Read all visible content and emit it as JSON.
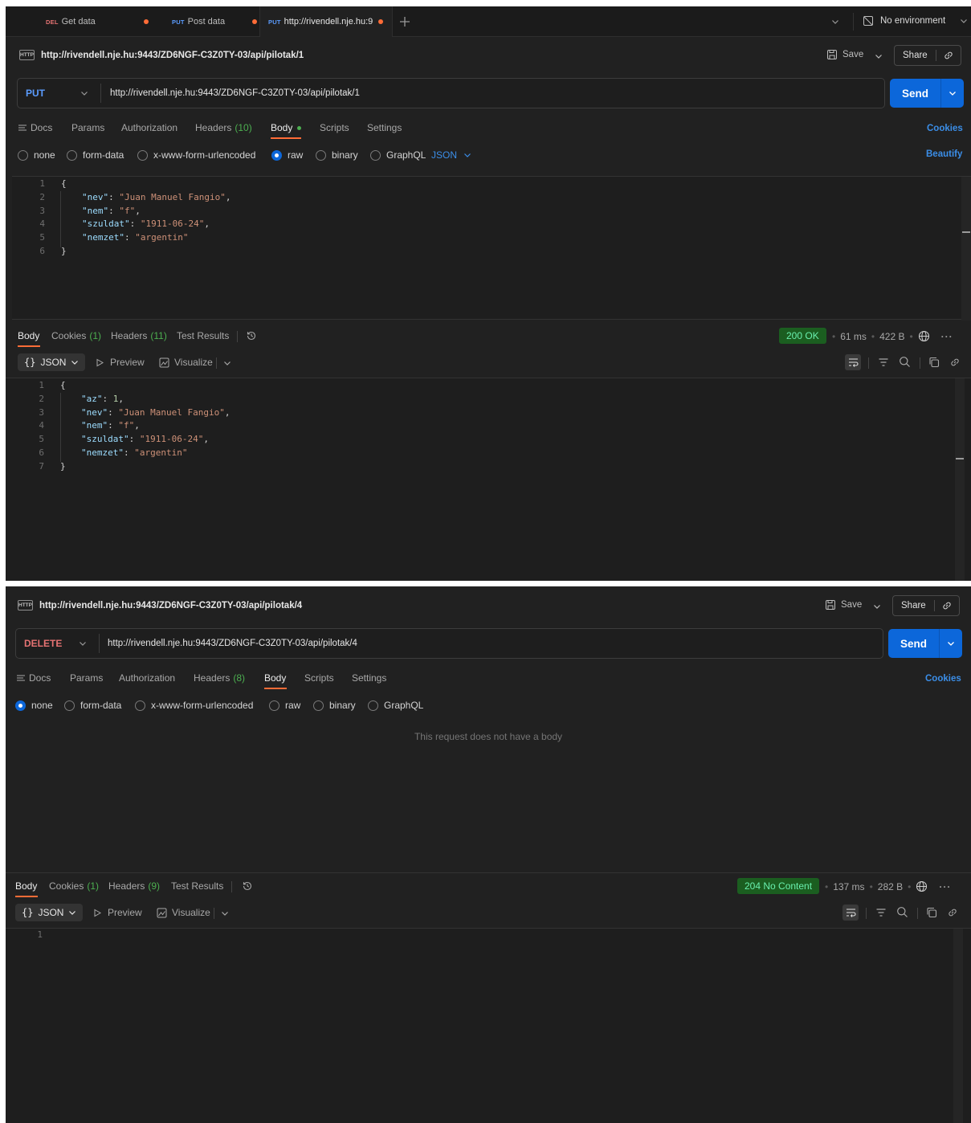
{
  "tabs": [
    {
      "method": "DEL",
      "label": "Get data"
    },
    {
      "method": "PUT",
      "label": "Post data"
    },
    {
      "method": "PUT",
      "label": "http://rivendell.nje.hu:9"
    }
  ],
  "environment": {
    "label": "No environment"
  },
  "actions": {
    "save": "Save",
    "share": "Share",
    "send": "Send",
    "cookies": "Cookies",
    "beautify": "Beautify"
  },
  "request_tabs": {
    "docs": "Docs",
    "params": "Params",
    "authorization": "Authorization",
    "headers": "Headers",
    "body": "Body",
    "scripts": "Scripts",
    "settings": "Settings"
  },
  "body_modes": {
    "none": "none",
    "form_data": "form-data",
    "urlencoded": "x-www-form-urlencoded",
    "raw": "raw",
    "binary": "binary",
    "graphql": "GraphQL",
    "json": "JSON"
  },
  "response_tabs": {
    "body": "Body",
    "cookies": "Cookies",
    "headers": "Headers",
    "test_results": "Test Results",
    "format": "JSON",
    "preview": "Preview",
    "visualize": "Visualize"
  },
  "panel1": {
    "title": "http://rivendell.nje.hu:9443/ZD6NGF-C3Z0TY-03/api/pilotak/1",
    "method": "PUT",
    "method_color": "#5b9cff",
    "url": "http://rivendell.nje.hu:9443/ZD6NGF-C3Z0TY-03/api/pilotak/1",
    "headers_count": "(10)",
    "request_lines": [
      [
        {
          "t": "p",
          "v": "{"
        }
      ],
      [
        {
          "t": "k",
          "v": "\"nev\""
        },
        {
          "t": "p",
          "v": ": "
        },
        {
          "t": "s",
          "v": "\"Juan Manuel Fangio\""
        },
        {
          "t": "p",
          "v": ","
        }
      ],
      [
        {
          "t": "k",
          "v": "\"nem\""
        },
        {
          "t": "p",
          "v": ": "
        },
        {
          "t": "s",
          "v": "\"f\""
        },
        {
          "t": "p",
          "v": ","
        }
      ],
      [
        {
          "t": "k",
          "v": "\"szuldat\""
        },
        {
          "t": "p",
          "v": ": "
        },
        {
          "t": "s",
          "v": "\"1911-06-24\""
        },
        {
          "t": "p",
          "v": ","
        }
      ],
      [
        {
          "t": "k",
          "v": "\"nemzet\""
        },
        {
          "t": "p",
          "v": ": "
        },
        {
          "t": "s",
          "v": "\"argentin\""
        }
      ],
      [
        {
          "t": "p",
          "v": "}"
        }
      ]
    ],
    "response": {
      "cookies_count": "(1)",
      "headers_count": "(11)",
      "status": "200 OK",
      "time": "61 ms",
      "size": "422 B"
    },
    "response_lines": [
      [
        {
          "t": "p",
          "v": "{"
        }
      ],
      [
        {
          "t": "k",
          "v": "\"az\""
        },
        {
          "t": "p",
          "v": ": "
        },
        {
          "t": "n",
          "v": "1"
        },
        {
          "t": "p",
          "v": ","
        }
      ],
      [
        {
          "t": "k",
          "v": "\"nev\""
        },
        {
          "t": "p",
          "v": ": "
        },
        {
          "t": "s",
          "v": "\"Juan Manuel Fangio\""
        },
        {
          "t": "p",
          "v": ","
        }
      ],
      [
        {
          "t": "k",
          "v": "\"nem\""
        },
        {
          "t": "p",
          "v": ": "
        },
        {
          "t": "s",
          "v": "\"f\""
        },
        {
          "t": "p",
          "v": ","
        }
      ],
      [
        {
          "t": "k",
          "v": "\"szuldat\""
        },
        {
          "t": "p",
          "v": ": "
        },
        {
          "t": "s",
          "v": "\"1911-06-24\""
        },
        {
          "t": "p",
          "v": ","
        }
      ],
      [
        {
          "t": "k",
          "v": "\"nemzet\""
        },
        {
          "t": "p",
          "v": ": "
        },
        {
          "t": "s",
          "v": "\"argentin\""
        }
      ],
      [
        {
          "t": "p",
          "v": "}"
        }
      ]
    ]
  },
  "panel2": {
    "title": "http://rivendell.nje.hu:9443/ZD6NGF-C3Z0TY-03/api/pilotak/4",
    "method": "DELETE",
    "method_color": "#e57373",
    "url": "http://rivendell.nje.hu:9443/ZD6NGF-C3Z0TY-03/api/pilotak/4",
    "headers_count": "(8)",
    "no_body_text": "This request does not have a body",
    "response": {
      "cookies_count": "(1)",
      "headers_count": "(9)",
      "status": "204 No Content",
      "time": "137 ms",
      "size": "282 B"
    },
    "response_lines": [
      []
    ]
  },
  "colors": {
    "accent": "#ff6c37",
    "send": "#0c67da",
    "link": "#3b8ee8",
    "ok_bg": "#1b5e20",
    "ok_text": "#69f0ae",
    "json_key": "#9cdcfe",
    "json_string": "#ce9178"
  }
}
